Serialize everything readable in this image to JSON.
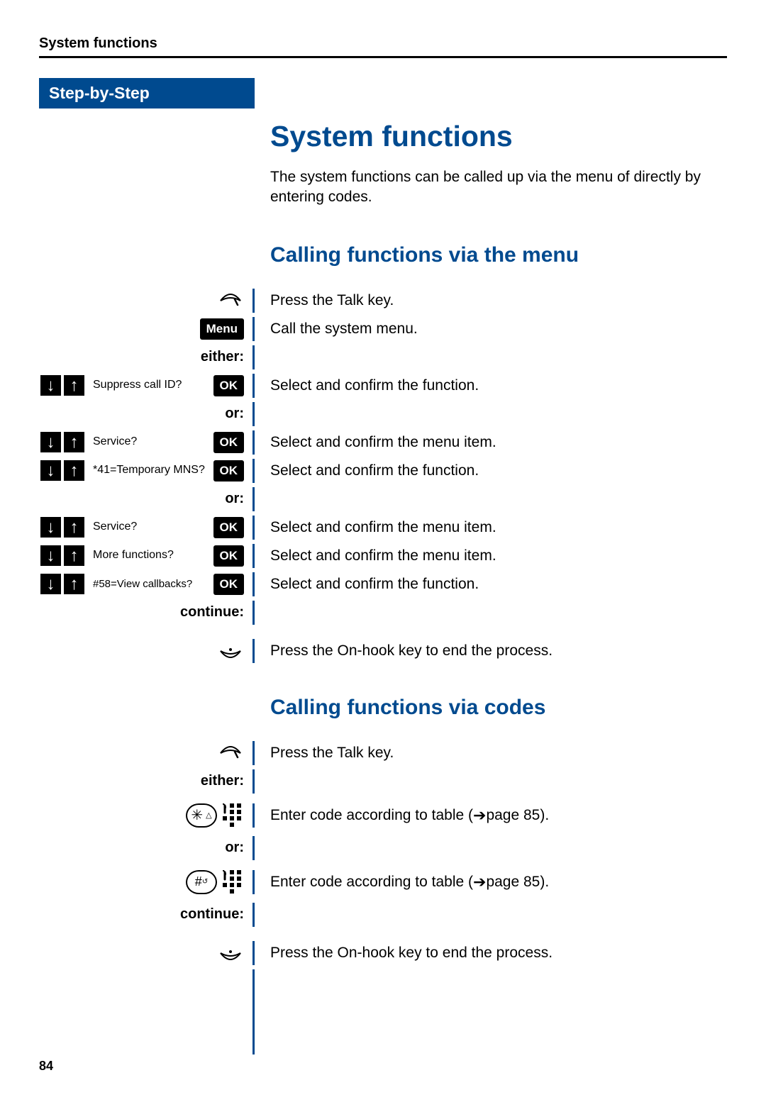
{
  "header": {
    "title": "System functions"
  },
  "sidebar": {
    "label": "Step-by-Step"
  },
  "main": {
    "h1": "System functions",
    "intro": "The system functions can be called up via the menu of directly by entering codes.",
    "section1": {
      "heading": "Calling functions via the menu",
      "steps": {
        "talk": "Press the Talk key.",
        "menu_btn": "Menu",
        "menu_instr": "Call the system menu.",
        "either": "either:",
        "suppress_label": "Suppress call ID?",
        "suppress_instr": "Select and confirm the function.",
        "or1": "or:",
        "service1_label": "Service?",
        "service1_instr": "Select and confirm the menu item.",
        "temp_label": "*41=Temporary MNS?",
        "temp_instr": "Select and confirm the function.",
        "or2": "or:",
        "service2_label": "Service?",
        "service2_instr": "Select and confirm the menu item.",
        "more_label": "More functions?",
        "more_instr": "Select and confirm the menu item.",
        "view_label": "#58=View callbacks?",
        "view_instr": "Select and confirm the function.",
        "continue": "continue:",
        "onhook_instr": "Press the On-hook key to end the process.",
        "ok": "OK"
      }
    },
    "section2": {
      "heading": "Calling functions via codes",
      "steps": {
        "talk": "Press the Talk key.",
        "either": "either:",
        "code1_prefix": "Enter code according to table (",
        "code1_ref": " page 85).",
        "or": "or:",
        "code2_prefix": "Enter code according to table (",
        "code2_ref": " page 85).",
        "continue": "continue:",
        "onhook_instr": "Press the On-hook key to end the process."
      }
    }
  },
  "footer": {
    "page": "84"
  }
}
